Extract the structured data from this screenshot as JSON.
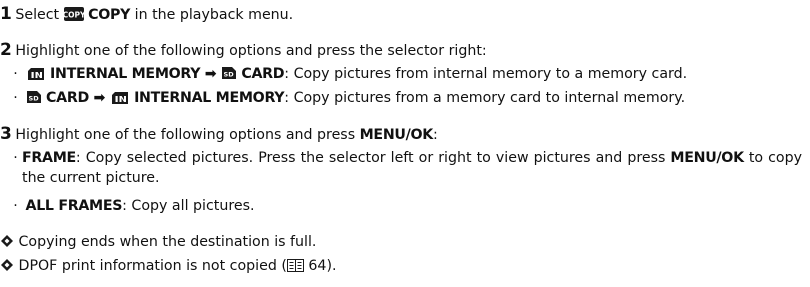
{
  "step1": {
    "number": "1",
    "pre": "Select",
    "icon": "copy-icon",
    "icon_text": "COPY",
    "label": "COPY",
    "post": "in the playback menu."
  },
  "step2": {
    "number": "2",
    "intro": "Highlight one of the following options and press the selector right:",
    "option1": {
      "from_icon": "internal-memory-icon",
      "from": "INTERNAL MEMORY",
      "arrow": "➡",
      "to_icon": "sd-card-icon",
      "to": "CARD",
      "desc": ": Copy pictures from internal memory to a memory card."
    },
    "option2": {
      "from_icon": "sd-card-icon",
      "from": "CARD",
      "arrow": "➡",
      "to_icon": "internal-memory-icon",
      "to": "INTERNAL MEMORY",
      "desc": ": Copy pictures from a memory card to internal memory."
    }
  },
  "step3": {
    "number": "3",
    "intro_pre": "Highlight one of the following options and press",
    "intro_button": "MENU/OK",
    "intro_post": ":",
    "option1": {
      "label": "FRAME",
      "desc": ": Copy selected pictures. Press the selector left or right to view pictures and press",
      "button": "MENU/OK",
      "desc2": "to copy the current picture."
    },
    "option2": {
      "label": "ALL FRAMES",
      "desc": ": Copy all pictures."
    }
  },
  "notes": [
    {
      "icon": "note-diamond-icon",
      "text": "Copying ends when the destination is full."
    },
    {
      "icon": "note-diamond-icon",
      "text": "DPOF print information is not copied (",
      "ref_icon": "book-reference-icon",
      "ref_page": "64",
      "close": ")."
    }
  ]
}
